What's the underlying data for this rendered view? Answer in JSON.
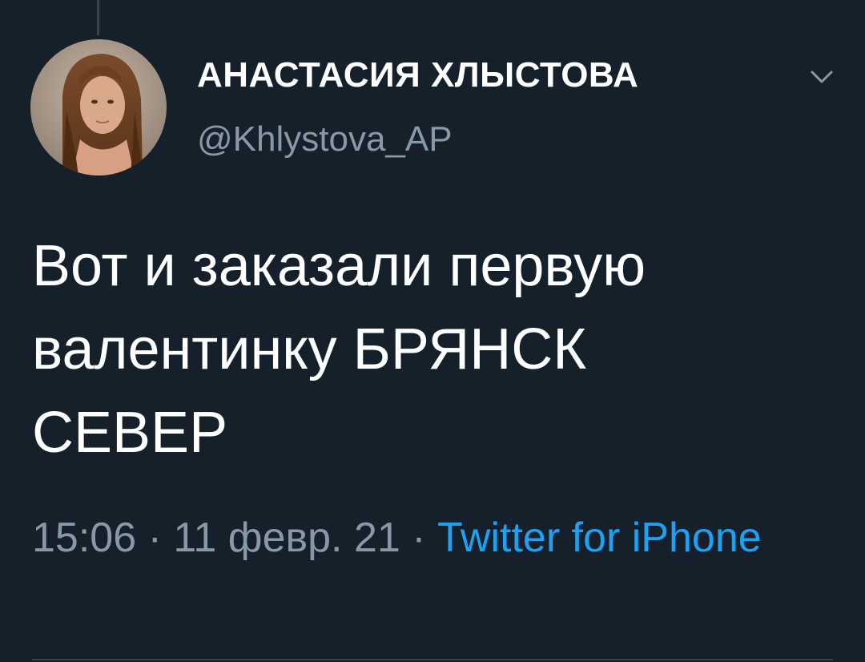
{
  "tweet": {
    "author": {
      "display_name": "АНАСТАСИЯ ХЛЫСТОВА",
      "handle": "@Khlystova_AP",
      "avatar_icon": "profile-photo",
      "menu_icon": "chevron-down-icon"
    },
    "text_lines": [
      "Вот и заказали первую",
      "валентинку БРЯНСК",
      "СЕВЕР"
    ],
    "meta": {
      "time": "15:06",
      "separator": "·",
      "date": "11 февр. 21",
      "source": "Twitter for iPhone"
    }
  },
  "colors": {
    "background": "#15202b",
    "primary_text": "#ffffff",
    "secondary_text": "#8899a6",
    "accent": "#1da1f2",
    "divider": "#38444d"
  }
}
